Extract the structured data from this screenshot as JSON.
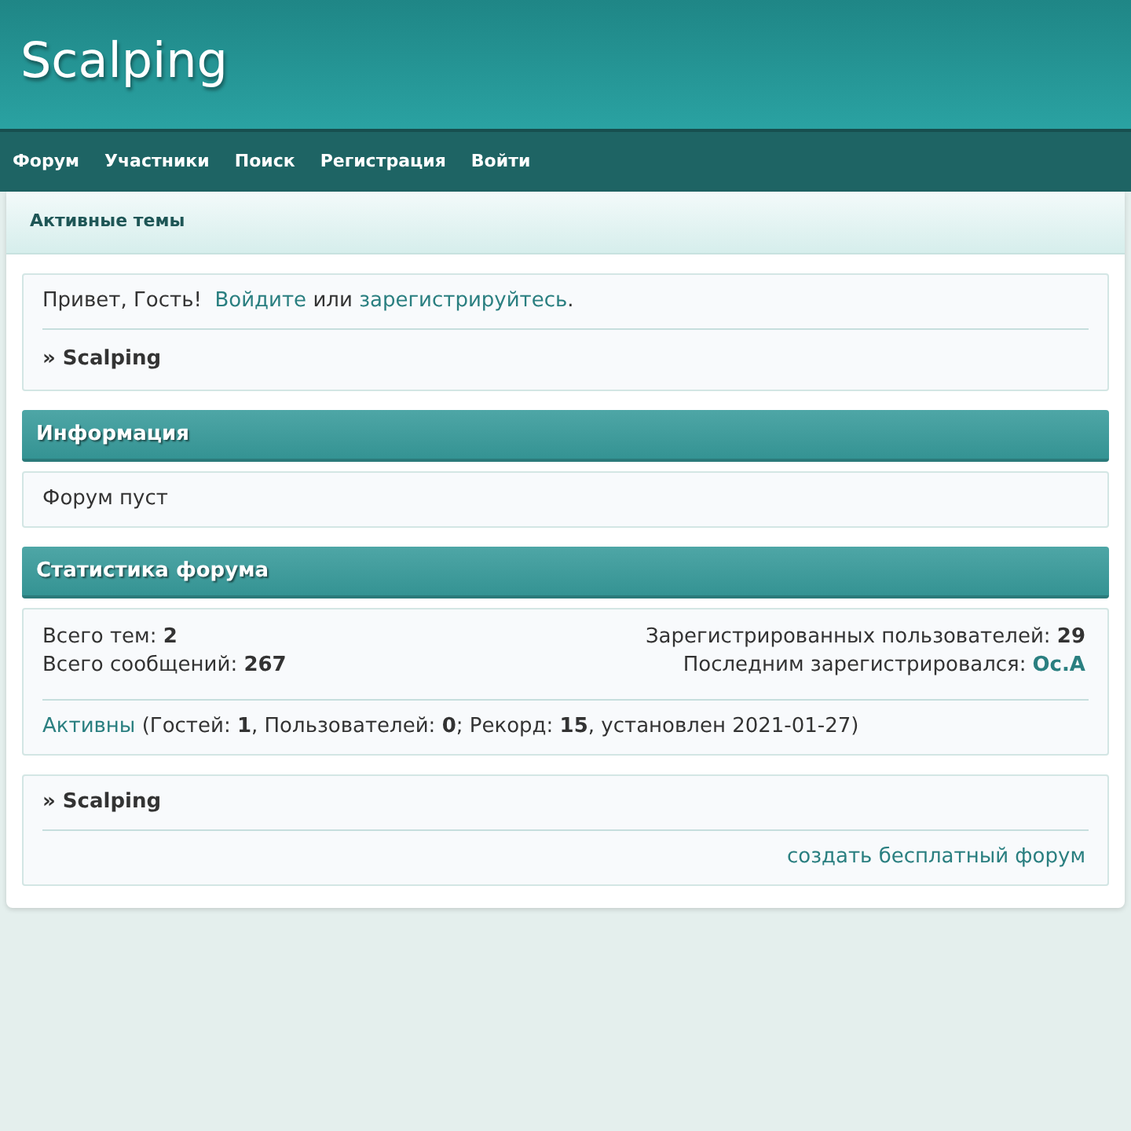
{
  "site_title": "Scalping",
  "nav": [
    "Форум",
    "Участники",
    "Поиск",
    "Регистрация",
    "Войти"
  ],
  "subbar": {
    "link": "Активные темы"
  },
  "welcome": {
    "greeting": "Привет, Гость!",
    "login_link": "Войдите",
    "or": "или",
    "register_link": "зарегистрируйтесь",
    "end": ".",
    "crumb": "» Scalping"
  },
  "info": {
    "title": "Информация",
    "text": "Форум пуст"
  },
  "stats": {
    "title": "Статистика форума",
    "left": [
      "Всего тем: **2**",
      "Всего сообщений: **267**"
    ],
    "registered": "Зарегистрированных пользователей: **29**",
    "last_label": "Последним зарегистрировался:",
    "last_user": "Ос.А",
    "online_link": "Активны",
    "online_text": " (Гостей: **1**, Пользователей: **0**; Рекорд: **15**, установлен 2021-01-27)"
  },
  "footer": {
    "crumb": "» Scalping",
    "link": "создать бесплатный форум"
  }
}
